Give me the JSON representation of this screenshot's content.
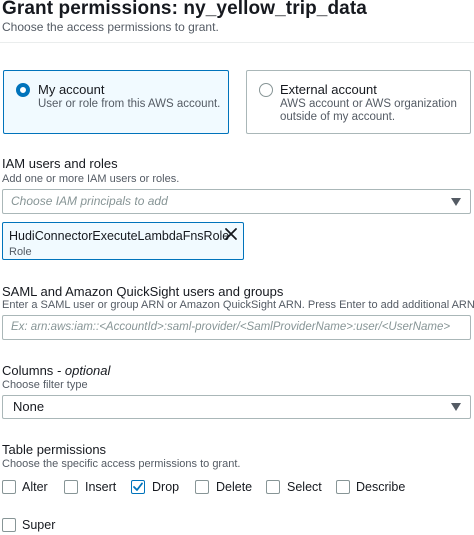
{
  "header": {
    "title": "Grant permissions: ny_yellow_trip_data",
    "subtitle": "Choose the access permissions to grant."
  },
  "account": {
    "options": [
      {
        "title": "My account",
        "description_line1": "User or role from this AWS account.",
        "description_line2": "",
        "selected": true
      },
      {
        "title": "External account",
        "description_line1": "AWS account or AWS organization",
        "description_line2": "outside of my account.",
        "selected": false
      }
    ]
  },
  "iam": {
    "label": "IAM users and roles",
    "hint": "Add one or more IAM users or roles.",
    "placeholder": "Choose IAM principals to add",
    "token": {
      "name": "HudiConnectorExecuteLambdaFnsRole",
      "type": "Role"
    }
  },
  "saml": {
    "label": "SAML and Amazon QuickSight users and groups",
    "hint": "Enter a SAML user or group ARN or Amazon QuickSight ARN. Press Enter to add additional ARNs.",
    "placeholder": "Ex: arn:aws:iam::<AccountId>:saml-provider/<SamlProviderName>:user/<UserName>"
  },
  "columns": {
    "label": "Columns",
    "label_suffix": "- optional",
    "hint": "Choose filter type",
    "selected": "None"
  },
  "table_permissions": {
    "label": "Table permissions",
    "hint": "Choose the specific access permissions to grant.",
    "items": [
      {
        "label": "Alter",
        "checked": false
      },
      {
        "label": "Insert",
        "checked": false
      },
      {
        "label": "Drop",
        "checked": true
      },
      {
        "label": "Delete",
        "checked": false
      },
      {
        "label": "Select",
        "checked": false
      },
      {
        "label": "Describe",
        "checked": false
      },
      {
        "label": "Super",
        "checked": false
      }
    ]
  },
  "colors": {
    "accent": "#0073bb",
    "border": "#aab7b8",
    "text": "#16191f",
    "muted": "#545b64"
  }
}
